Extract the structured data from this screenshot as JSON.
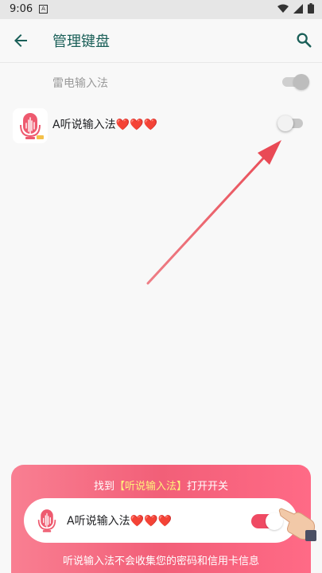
{
  "status_bar": {
    "time": "9:06",
    "notification_badge": "A",
    "icons": [
      "wifi-icon",
      "signal-icon",
      "battery-icon"
    ]
  },
  "app_bar": {
    "title": "管理键盘",
    "back_icon": "arrow-left-icon",
    "search_icon": "search-icon"
  },
  "keyboards": [
    {
      "name": "雷电输入法",
      "enabled": true,
      "disabled_look": true
    },
    {
      "name": "A听说输入法❤️❤️❤️",
      "enabled": false
    }
  ],
  "overlay_arrow": {
    "color": "#e94a55"
  },
  "guide": {
    "title_prefix": "找到",
    "title_highlight": "【听说输入法】",
    "title_suffix": "打开开关",
    "app_name": "A听说输入法❤️❤️❤️",
    "toggle_enabled": true,
    "note": "听说输入法不会收集您的密码和信用卡信息",
    "colors": {
      "card_start": "#f97f92",
      "card_end": "#ff6a86",
      "highlight": "#fff27a",
      "toggle": "#ef4a63"
    }
  },
  "accent": "#1a5f58"
}
